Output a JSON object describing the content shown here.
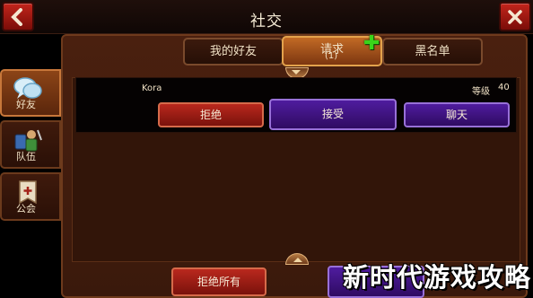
{
  "header": {
    "title": "社交"
  },
  "tabs": [
    {
      "label": "我的好友"
    },
    {
      "label": "请求",
      "count": "(1)"
    },
    {
      "label": "黑名单"
    }
  ],
  "sidebar": [
    {
      "label": "好友",
      "icon": "chat-bubbles-icon"
    },
    {
      "label": "队伍",
      "icon": "party-icon"
    },
    {
      "label": "公会",
      "icon": "guild-banner-icon"
    }
  ],
  "request": {
    "player_name": "Kora",
    "level_label": "等级",
    "level_value": "40",
    "reject_label": "拒绝",
    "accept_label": "接受",
    "chat_label": "聊天"
  },
  "footer": {
    "reject_all_label": "拒绝所有"
  },
  "watermark": "新时代游戏攻略",
  "colors": {
    "accent_red": "#b9281d",
    "accent_purple": "#4f1c9e",
    "plus_green": "#3ad41a"
  }
}
